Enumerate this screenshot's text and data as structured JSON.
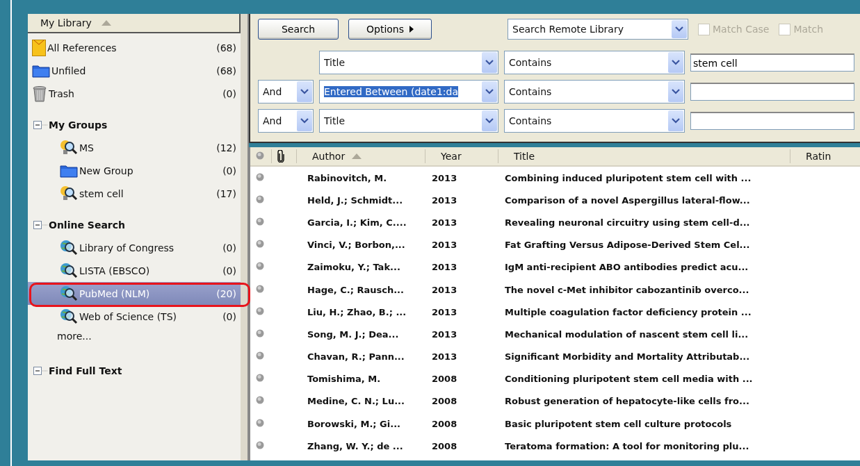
{
  "sidebar": {
    "header": {
      "label": "My Library",
      "sorted": true
    },
    "library_items": [
      {
        "kind": "envelope",
        "label": "All References",
        "count": "(68)",
        "selected": false
      },
      {
        "kind": "folder",
        "label": "Unfiled",
        "count": "(68)",
        "selected": false
      },
      {
        "kind": "trash",
        "label": "Trash",
        "count": "(0)",
        "selected": false
      }
    ],
    "sections": [
      {
        "title": "My Groups",
        "expanded": true,
        "items": [
          {
            "kind": "group",
            "label": "MS",
            "count": "(12)",
            "selected": false,
            "circled": false
          },
          {
            "kind": "folder",
            "label": "New Group",
            "count": "(0)",
            "selected": false,
            "circled": false
          },
          {
            "kind": "group",
            "label": "stem cell",
            "count": "(17)",
            "selected": false,
            "circled": false
          }
        ]
      },
      {
        "title": "Online Search",
        "expanded": true,
        "items": [
          {
            "kind": "online",
            "label": "Library of Congress",
            "count": "(0)",
            "selected": false,
            "circled": false
          },
          {
            "kind": "online",
            "label": "LISTA (EBSCO)",
            "count": "(0)",
            "selected": false,
            "circled": false
          },
          {
            "kind": "online",
            "label": "PubMed (NLM)",
            "count": "(20)",
            "selected": true,
            "circled": true
          },
          {
            "kind": "online",
            "label": "Web of Science (TS)",
            "count": "(0)",
            "selected": false,
            "circled": false
          }
        ],
        "more": "more..."
      },
      {
        "title": "Find Full Text",
        "expanded": true
      }
    ]
  },
  "search_panel": {
    "buttons": [
      "Search",
      "Options"
    ],
    "scope": "Search Remote Library",
    "checkboxes": [
      {
        "label": "Match Case",
        "checked": false,
        "disabled": true
      },
      {
        "label": "Match",
        "checked": false,
        "disabled": true
      }
    ],
    "rows": [
      {
        "connector": null,
        "field": "Title",
        "field_selected": false,
        "operator": "Contains",
        "value": "stem cell"
      },
      {
        "connector": "And",
        "field": "Entered Between (date1:da",
        "field_selected": true,
        "operator": "Contains",
        "value": null
      },
      {
        "connector": "And",
        "field": "Title",
        "field_selected": false,
        "operator": "Contains",
        "value": null
      }
    ]
  },
  "table": {
    "columns": [
      {
        "kind": "status"
      },
      {
        "kind": "attachment"
      },
      {
        "kind": "text",
        "label": "Author",
        "sorted": true
      },
      {
        "kind": "text",
        "label": "Year"
      },
      {
        "kind": "text",
        "label": "Title"
      },
      {
        "kind": "text",
        "label": "Ratin"
      }
    ],
    "rows": [
      {
        "author": "Rabinovitch, M.",
        "year": "2013",
        "title": "Combining induced pluripotent stem cell with ..."
      },
      {
        "author": "Held, J.; Schmidt...",
        "year": "2013",
        "title": "Comparison of a novel Aspergillus lateral-flow..."
      },
      {
        "author": "Garcia, I.; Kim, C....",
        "year": "2013",
        "title": "Revealing neuronal circuitry using stem cell-d..."
      },
      {
        "author": "Vinci, V.; Borbon,...",
        "year": "2013",
        "title": "Fat Grafting Versus Adipose-Derived Stem Cel..."
      },
      {
        "author": "Zaimoku, Y.; Tak...",
        "year": "2013",
        "title": "IgM anti-recipient ABO antibodies predict acu..."
      },
      {
        "author": "Hage, C.; Rausch...",
        "year": "2013",
        "title": "The novel c-Met inhibitor cabozantinib overco..."
      },
      {
        "author": "Liu, H.; Zhao, B.; ...",
        "year": "2013",
        "title": "Multiple coagulation factor deficiency protein ..."
      },
      {
        "author": "Song, M. J.; Dea...",
        "year": "2013",
        "title": "Mechanical modulation of nascent stem cell li..."
      },
      {
        "author": "Chavan, R.; Pann...",
        "year": "2013",
        "title": "Significant Morbidity and Mortality Attributab..."
      },
      {
        "author": "Tomishima, M.",
        "year": "2008",
        "title": "Conditioning pluripotent stem cell media with ..."
      },
      {
        "author": "Medine, C. N.; Lu...",
        "year": "2008",
        "title": "Robust generation of hepatocyte-like cells fro..."
      },
      {
        "author": "Borowski, M.; Gi...",
        "year": "2008",
        "title": "Basic pluripotent stem cell culture protocols"
      },
      {
        "author": "Zhang, W. Y.; de ...",
        "year": "2008",
        "title": "Teratoma formation: A tool for monitoring plu..."
      }
    ]
  }
}
